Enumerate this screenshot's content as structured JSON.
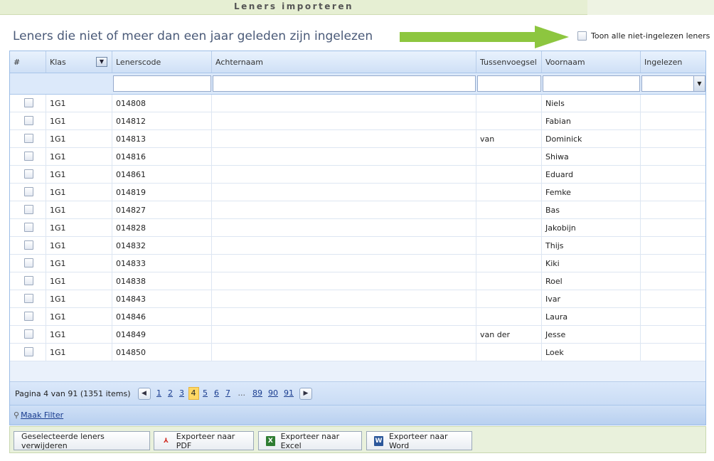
{
  "window": {
    "title": "Leners importeren"
  },
  "heading": "Leners die niet of meer dan een jaar geleden zijn ingelezen",
  "toon_checkbox_label": "Toon alle niet-ingelezen leners",
  "colors": {
    "accent_arrow": "#8dc63f",
    "header_blue": "#cfe0f6",
    "current_page": "#ffd764"
  },
  "columns": [
    "#",
    "Klas",
    "Lenerscode",
    "Achternaam",
    "Tussenvoegsel",
    "Voornaam",
    "Ingelezen"
  ],
  "rows": [
    {
      "klas": "1G1",
      "code": "014808",
      "achternaam": "",
      "tussenvoegsel": "",
      "voornaam": "Niels"
    },
    {
      "klas": "1G1",
      "code": "014812",
      "achternaam": "",
      "tussenvoegsel": "",
      "voornaam": "Fabian"
    },
    {
      "klas": "1G1",
      "code": "014813",
      "achternaam": "",
      "tussenvoegsel": "van",
      "voornaam": "Dominick"
    },
    {
      "klas": "1G1",
      "code": "014816",
      "achternaam": "",
      "tussenvoegsel": "",
      "voornaam": "Shiwa"
    },
    {
      "klas": "1G1",
      "code": "014861",
      "achternaam": "",
      "tussenvoegsel": "",
      "voornaam": "Eduard"
    },
    {
      "klas": "1G1",
      "code": "014819",
      "achternaam": "",
      "tussenvoegsel": "",
      "voornaam": "Femke"
    },
    {
      "klas": "1G1",
      "code": "014827",
      "achternaam": "",
      "tussenvoegsel": "",
      "voornaam": "Bas"
    },
    {
      "klas": "1G1",
      "code": "014828",
      "achternaam": "",
      "tussenvoegsel": "",
      "voornaam": "Jakobijn"
    },
    {
      "klas": "1G1",
      "code": "014832",
      "achternaam": "",
      "tussenvoegsel": "",
      "voornaam": "Thijs"
    },
    {
      "klas": "1G1",
      "code": "014833",
      "achternaam": "",
      "tussenvoegsel": "",
      "voornaam": "Kiki"
    },
    {
      "klas": "1G1",
      "code": "014838",
      "achternaam": "",
      "tussenvoegsel": "",
      "voornaam": "Roel"
    },
    {
      "klas": "1G1",
      "code": "014843",
      "achternaam": "",
      "tussenvoegsel": "",
      "voornaam": "Ivar"
    },
    {
      "klas": "1G1",
      "code": "014846",
      "achternaam": "",
      "tussenvoegsel": "",
      "voornaam": "Laura"
    },
    {
      "klas": "1G1",
      "code": "014849",
      "achternaam": "",
      "tussenvoegsel": "van der",
      "voornaam": "Jesse"
    },
    {
      "klas": "1G1",
      "code": "014850",
      "achternaam": "",
      "tussenvoegsel": "",
      "voornaam": "Loek"
    }
  ],
  "pager": {
    "info": "Pagina 4 van 91 (1351 items)",
    "prev_icon": "chevron-left-icon",
    "next_icon": "chevron-right-icon",
    "pages": [
      "1",
      "2",
      "3",
      "4",
      "5",
      "6",
      "7",
      "...",
      "89",
      "90",
      "91"
    ],
    "current": "4"
  },
  "filter_link": "Maak Filter",
  "toolbar": {
    "delete_label": "Geselecteerde leners verwijderen",
    "pdf_label": "Exporteer naar PDF",
    "excel_label": "Exporteer naar Excel",
    "word_label": "Exporteer naar Word"
  }
}
